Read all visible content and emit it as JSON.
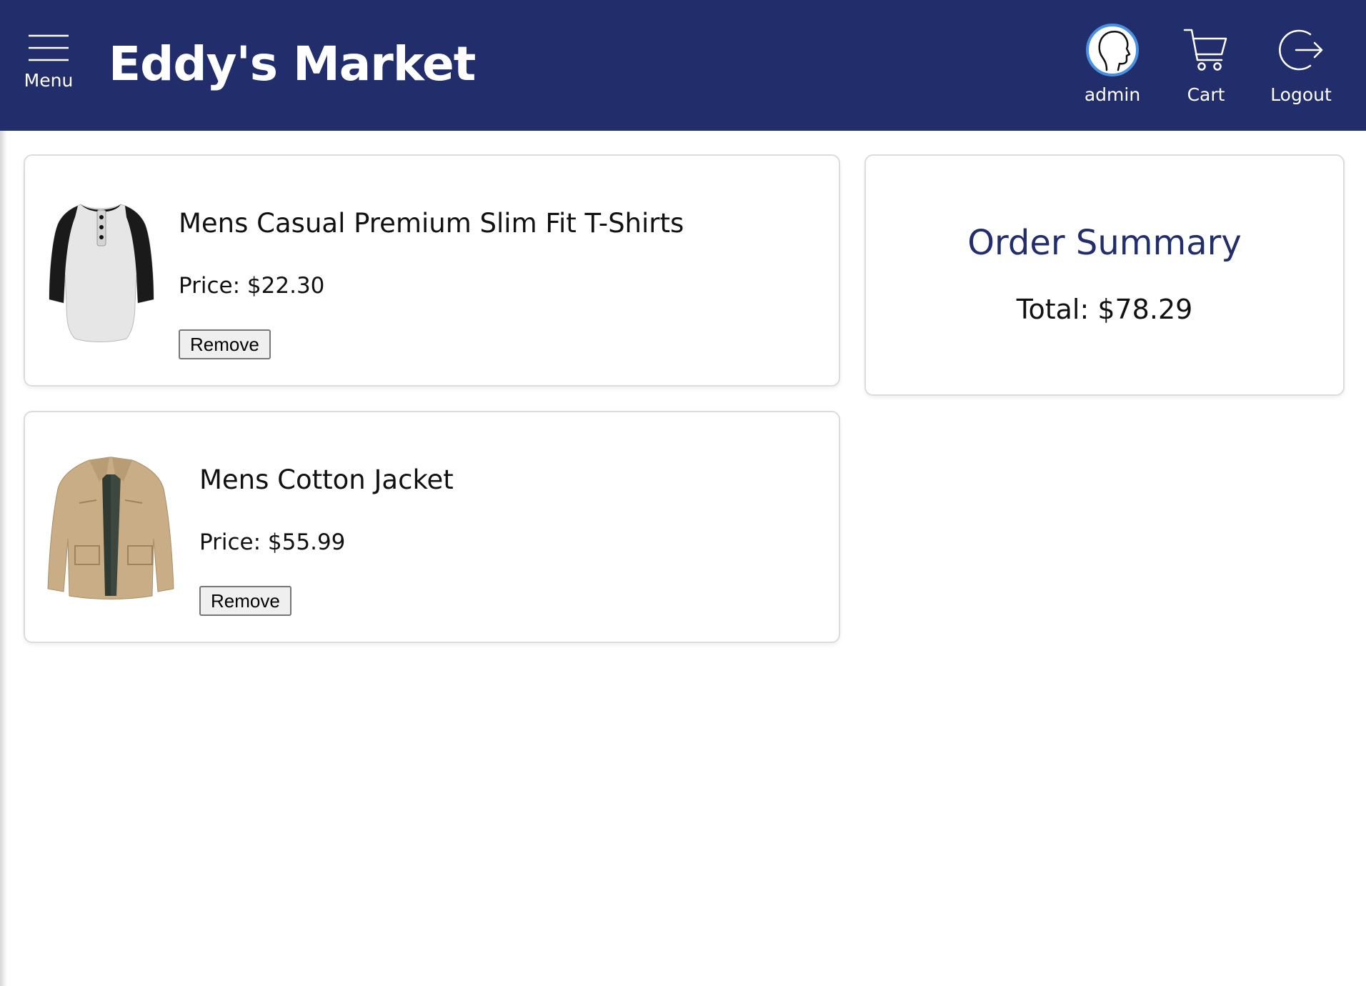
{
  "header": {
    "menu_label": "Menu",
    "brand": "Eddy's Market",
    "nav": {
      "admin_label": "admin",
      "cart_label": "Cart",
      "logout_label": "Logout"
    }
  },
  "cart": {
    "items": [
      {
        "name": "Mens Casual Premium Slim Fit T-Shirts",
        "price": "Price: $22.30",
        "remove_label": "Remove",
        "image_alt": "t-shirt-image"
      },
      {
        "name": "Mens Cotton Jacket",
        "price": "Price: $55.99",
        "remove_label": "Remove",
        "image_alt": "jacket-image"
      }
    ]
  },
  "summary": {
    "title": "Order Summary",
    "total": "Total: $78.29"
  },
  "colors": {
    "header_bg": "#222e6b",
    "accent": "#222e6b",
    "avatar_ring": "#4a90e2"
  }
}
